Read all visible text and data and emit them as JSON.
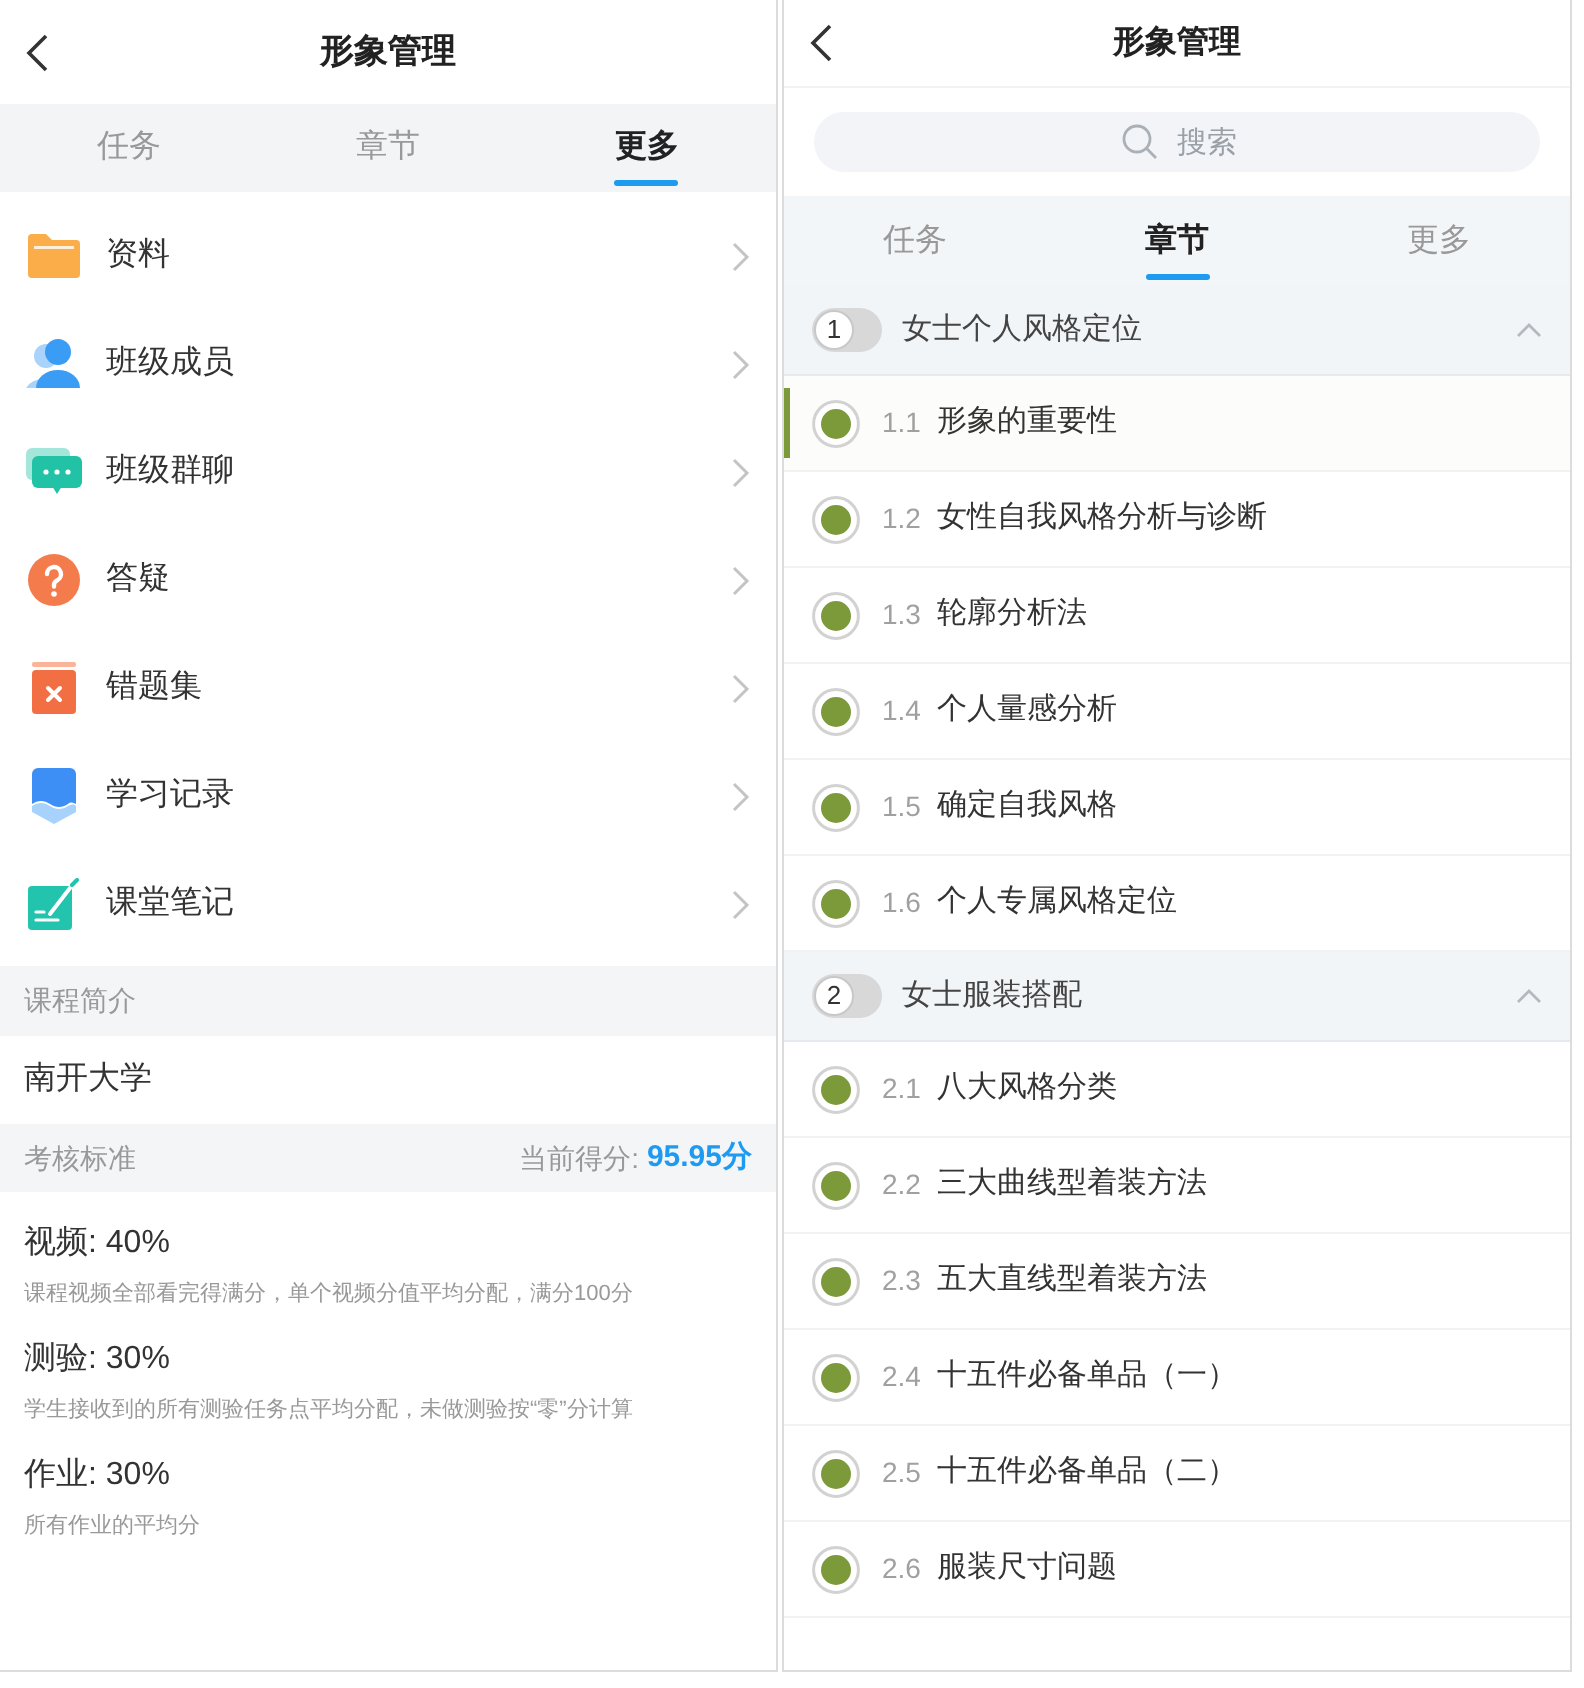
{
  "left_panel": {
    "header": {
      "title": "形象管理"
    },
    "tabs": [
      {
        "label": "任务",
        "selected": false
      },
      {
        "label": "章节",
        "selected": false
      },
      {
        "label": "更多",
        "selected": true
      }
    ],
    "menu_items": [
      {
        "label": "资料"
      },
      {
        "label": "班级成员"
      },
      {
        "label": "班级群聊"
      },
      {
        "label": "答疑"
      },
      {
        "label": "错题集"
      },
      {
        "label": "学习记录"
      },
      {
        "label": "课堂笔记"
      }
    ],
    "course_intro": {
      "heading": "课程简介",
      "school": "南开大学"
    },
    "assessment": {
      "heading": "考核标准",
      "score_label": "当前得分:",
      "score": "95.95分",
      "criteria": [
        {
          "title": "视频: 40%",
          "description": "课程视频全部看完得满分，单个视频分值平均分配，满分100分"
        },
        {
          "title": "测验: 30%",
          "description": "学生接收到的所有测验任务点平均分配，未做测验按“零”分计算"
        },
        {
          "title": "作业: 30%",
          "description": "所有作业的平均分"
        }
      ]
    }
  },
  "right_panel": {
    "header": {
      "title": "形象管理"
    },
    "search": {
      "placeholder": "搜索"
    },
    "tabs": [
      {
        "label": "任务",
        "selected": false
      },
      {
        "label": "章节",
        "selected": true
      },
      {
        "label": "更多",
        "selected": false
      }
    ],
    "chapters": [
      {
        "number": "1",
        "title": "女士个人风格定位",
        "expanded": true,
        "children": [
          {
            "number": "1.1",
            "title": "形象的重要性",
            "completed": true,
            "selected": true
          },
          {
            "number": "1.2",
            "title": "女性自我风格分析与诊断",
            "completed": true,
            "selected": false
          },
          {
            "number": "1.3",
            "title": "轮廓分析法",
            "completed": true,
            "selected": false
          },
          {
            "number": "1.4",
            "title": "个人量感分析",
            "completed": true,
            "selected": false
          },
          {
            "number": "1.5",
            "title": "确定自我风格",
            "completed": true,
            "selected": false
          },
          {
            "number": "1.6",
            "title": "个人专属风格定位",
            "completed": true,
            "selected": false
          }
        ]
      },
      {
        "number": "2",
        "title": "女士服装搭配",
        "expanded": true,
        "children": [
          {
            "number": "2.1",
            "title": "八大风格分类",
            "completed": true,
            "selected": false
          },
          {
            "number": "2.2",
            "title": "三大曲线型着装方法",
            "completed": true,
            "selected": false
          },
          {
            "number": "2.3",
            "title": "五大直线型着装方法",
            "completed": true,
            "selected": false
          },
          {
            "number": "2.4",
            "title": "十五件必备单品（一）",
            "completed": true,
            "selected": false
          },
          {
            "number": "2.5",
            "title": "十五件必备单品（二）",
            "completed": true,
            "selected": false
          },
          {
            "number": "2.6",
            "title": "服装尺寸问题",
            "completed": true,
            "selected": false
          }
        ]
      }
    ]
  }
}
